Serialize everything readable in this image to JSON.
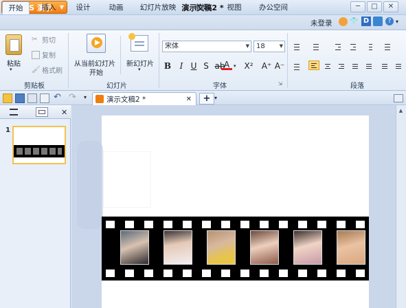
{
  "app": {
    "name": "WPS 演示",
    "title": "演示文稿2 *"
  },
  "window_buttons": [
    "─",
    "□",
    "✕"
  ],
  "tabs": [
    "开始",
    "插入",
    "设计",
    "动画",
    "幻灯片放映",
    "审阅",
    "视图",
    "办公空间"
  ],
  "user": {
    "login": "未登录"
  },
  "ribbon": {
    "clipboard": {
      "paste": "粘贴",
      "cut": "剪切",
      "copy": "复制",
      "format_painter": "格式刷",
      "group": "剪贴板"
    },
    "slides": {
      "from_current": "从当前幻灯片",
      "start": "开始",
      "new_slide": "新幻灯片",
      "group": "幻灯片"
    },
    "font": {
      "name": "宋体",
      "size": "18",
      "group": "字体"
    },
    "paragraph": {
      "group": "段落"
    }
  },
  "doc_tab": {
    "label": "演示文稿2 *"
  },
  "thumbnail": {
    "number": "1"
  },
  "colors": {
    "accent": "#f07d10",
    "ribbon": "#e2ebf6",
    "selected": "#ffd87a"
  }
}
